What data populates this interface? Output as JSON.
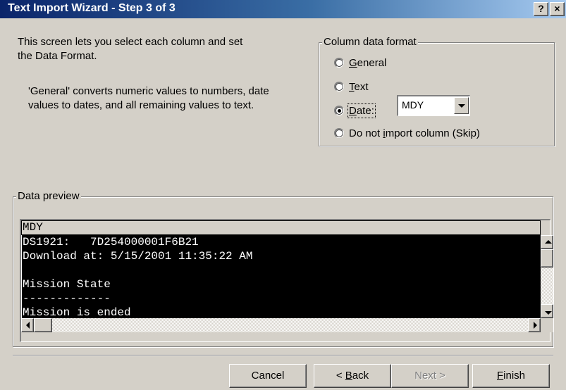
{
  "window": {
    "title": "Text Import Wizard - Step 3 of 3",
    "help_glyph": "?",
    "close_glyph": "×"
  },
  "description": {
    "line1": "This screen lets you select each column and set",
    "line2": "the Data Format.",
    "line3": "'General' converts numeric values to numbers, date",
    "line4": "values to dates, and all remaining values to text."
  },
  "format": {
    "legend": "Column data format",
    "options": [
      {
        "key": "G",
        "rest": "eneral",
        "checked": false
      },
      {
        "key": "T",
        "rest": "ext",
        "checked": false
      },
      {
        "key": "D",
        "rest": "ate:",
        "checked": true
      },
      {
        "pre": "Do not ",
        "key": "i",
        "rest": "mport column (Skip)",
        "checked": false
      }
    ],
    "date_value": "MDY"
  },
  "preview": {
    "legend": "Data preview",
    "column_header": "MDY",
    "lines": [
      "DS1921:   7D254000001F6B21",
      "Download at: 5/15/2001 11:35:22 AM",
      "",
      "Mission State",
      "-------------",
      "Mission is ended"
    ]
  },
  "buttons": {
    "cancel": "Cancel",
    "back_pre": "< ",
    "back_key": "B",
    "back_rest": "ack",
    "next": "Next >",
    "finish_key": "F",
    "finish_rest": "inish"
  },
  "colors": {
    "title_bar_start": "#0a246a",
    "title_bar_end": "#a6caf0",
    "dialog_bg": "#d4d0c8",
    "preview_bg": "#000000",
    "preview_fg": "#ffffff"
  }
}
